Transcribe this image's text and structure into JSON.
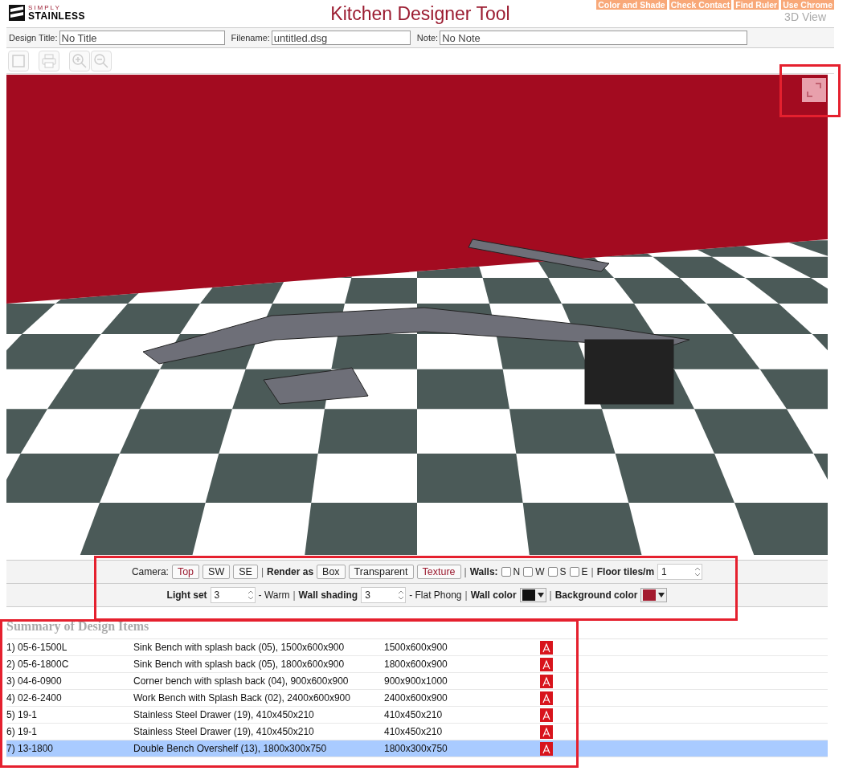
{
  "logo": {
    "top": "SIMPLY",
    "bottom": "STAINLESS"
  },
  "title": "Kitchen Designer Tool",
  "top_links": [
    "Color and Shade",
    "Check Contact",
    "Find Ruler",
    "Use Chrome"
  ],
  "view_label": "3D View",
  "fields": [
    {
      "label": "Design Title:",
      "value": "No Title"
    },
    {
      "label": "Filename:",
      "value": "untitled.dsg"
    },
    {
      "label": "Note:",
      "value": "No Note"
    }
  ],
  "toolbar": [
    {
      "kind": "new"
    },
    {
      "kind": "print"
    },
    {
      "kind": "zoom-in"
    },
    {
      "kind": "zoom-out"
    }
  ],
  "controls": {
    "row1": [
      {
        "kind": "label",
        "text": "Camera:"
      },
      {
        "kind": "button",
        "text": "Top",
        "selected": true
      },
      {
        "kind": "button",
        "text": "SW",
        "selected": false
      },
      {
        "kind": "button",
        "text": "SE",
        "selected": false
      },
      {
        "kind": "sep",
        "text": "|"
      },
      {
        "kind": "bold",
        "text": "Render as"
      },
      {
        "kind": "button",
        "text": "Box",
        "selected": false
      },
      {
        "kind": "button",
        "text": "Transparent",
        "selected": false
      },
      {
        "kind": "button",
        "text": "Texture",
        "selected": true
      },
      {
        "kind": "sep",
        "text": "|"
      },
      {
        "kind": "bold",
        "text": "Walls:"
      },
      {
        "kind": "checkbox",
        "text": "N",
        "checked": false
      },
      {
        "kind": "checkbox",
        "text": "W",
        "checked": false
      },
      {
        "kind": "checkbox",
        "text": "S",
        "checked": false
      },
      {
        "kind": "checkbox",
        "text": "E",
        "checked": false
      },
      {
        "kind": "sep",
        "text": "|"
      },
      {
        "kind": "bold",
        "text": "Floor tiles/m"
      },
      {
        "kind": "spin",
        "text": "1"
      }
    ],
    "row2": [
      {
        "kind": "bold",
        "text": "Light set"
      },
      {
        "kind": "spin",
        "text": "3"
      },
      {
        "kind": "label",
        "text": "- Warm"
      },
      {
        "kind": "sep",
        "text": "|"
      },
      {
        "kind": "bold",
        "text": "Wall shading"
      },
      {
        "kind": "spin",
        "text": "3"
      },
      {
        "kind": "label",
        "text": "- Flat Phong"
      },
      {
        "kind": "sep",
        "text": "|"
      },
      {
        "kind": "bold",
        "text": "Wall color"
      },
      {
        "kind": "color",
        "color": "#111111"
      },
      {
        "kind": "sep",
        "text": "|"
      },
      {
        "kind": "bold",
        "text": "Background color"
      },
      {
        "kind": "color",
        "color": "#a31a2e"
      }
    ]
  },
  "summary": {
    "title": "Summary of Design Items",
    "rows": [
      {
        "code": "1) 05-6-1500L",
        "description": "Sink Bench with splash back (05), 1500x600x900",
        "size": "1500x600x900",
        "selected": false
      },
      {
        "code": "2) 05-6-1800C",
        "description": "Sink Bench with splash back (05), 1800x600x900",
        "size": "1800x600x900",
        "selected": false
      },
      {
        "code": "3) 04-6-0900",
        "description": "Corner bench with splash back (04), 900x600x900",
        "size": "900x900x1000",
        "selected": false
      },
      {
        "code": "4) 02-6-2400",
        "description": "Work Bench with Splash Back (02), 2400x600x900",
        "size": "2400x600x900",
        "selected": false
      },
      {
        "code": "5) 19-1",
        "description": "Stainless Steel Drawer (19), 410x450x210",
        "size": "410x450x210",
        "selected": false
      },
      {
        "code": "6) 19-1",
        "description": "Stainless Steel Drawer (19), 410x450x210",
        "size": "410x450x210",
        "selected": false
      },
      {
        "code": "7) 13-1800",
        "description": "Double Bench Overshelf (13), 1800x300x750",
        "size": "1800x300x750",
        "selected": true
      }
    ]
  }
}
